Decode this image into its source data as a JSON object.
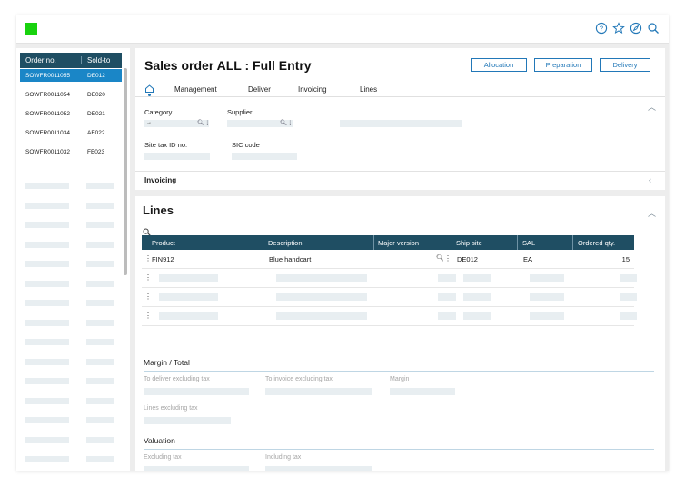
{
  "colors": {
    "brand": "#18d20e",
    "header_bg": "#1f4e63",
    "accent": "#2278b8",
    "selected_row": "#1a86c7"
  },
  "topbar": {
    "icons": [
      "help-icon",
      "star-icon",
      "compass-icon",
      "search-icon"
    ]
  },
  "order_list": {
    "columns": [
      "Order no.",
      "Sold-to"
    ],
    "rows": [
      {
        "order": "SOWFR0011055",
        "sold_to": "DE012",
        "selected": true
      },
      {
        "order": "SOWFR0011054",
        "sold_to": "DE020",
        "selected": false
      },
      {
        "order": "SOWFR0011052",
        "sold_to": "DE021",
        "selected": false
      },
      {
        "order": "SOWFR0011034",
        "sold_to": "AE022",
        "selected": false
      },
      {
        "order": "SOWFR0011032",
        "sold_to": "FE023",
        "selected": false
      }
    ]
  },
  "header": {
    "title": "Sales order ALL : Full Entry",
    "buttons": [
      "Allocation",
      "Preparation",
      "Delivery"
    ],
    "tabs": [
      "Management",
      "Deliver",
      "Invoicing",
      "Lines"
    ],
    "fields": {
      "category_label": "Category",
      "category_value": "→",
      "supplier_label": "Supplier",
      "site_tax_label": "Site tax ID no.",
      "sic_label": "SIC code"
    }
  },
  "invoicing": {
    "title": "Invoicing"
  },
  "lines": {
    "title": "Lines",
    "columns": [
      "Product",
      "Description",
      "Major version",
      "Ship site",
      "SAL",
      "Ordered qty."
    ],
    "rows": [
      {
        "product": "FIN912",
        "description": "Blue handcart",
        "major_version": "",
        "ship_site": "DE012",
        "sal": "EA",
        "ordered_qty": "15"
      }
    ]
  },
  "margin_total": {
    "title": "Margin / Total",
    "fields": [
      "To deliver excluding tax",
      "To invoice excluding tax",
      "Margin",
      "Lines excluding tax"
    ]
  },
  "valuation": {
    "title": "Valuation",
    "fields": [
      "Excluding tax",
      "Including tax"
    ]
  }
}
